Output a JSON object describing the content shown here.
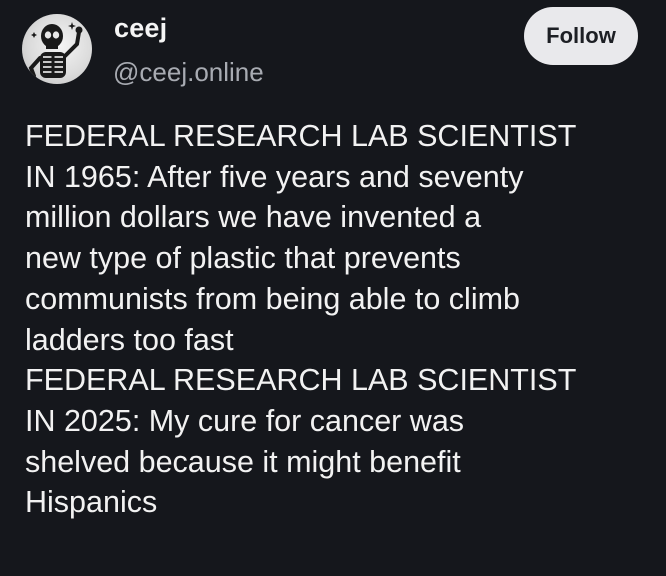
{
  "post": {
    "username": "ceej",
    "handle": "@ceej.online",
    "follow_label": "Follow",
    "avatar_icon": "skeleton-avatar-icon",
    "body_lines": [
      "FEDERAL RESEARCH LAB SCIENTIST",
      "IN 1965: After five years and seventy",
      "million dollars we have invented a",
      "new type of plastic that prevents",
      "communists from being able to climb",
      "ladders too fast",
      "FEDERAL RESEARCH LAB SCIENTIST",
      "IN 2025: My cure for cancer was",
      "shelved because it might benefit",
      "Hispanics"
    ]
  },
  "colors": {
    "background": "#15171c",
    "text": "#f2f2f2",
    "handle": "#a8abb2",
    "follow_bg": "#e9e9ec",
    "follow_text": "#1d1f24"
  }
}
